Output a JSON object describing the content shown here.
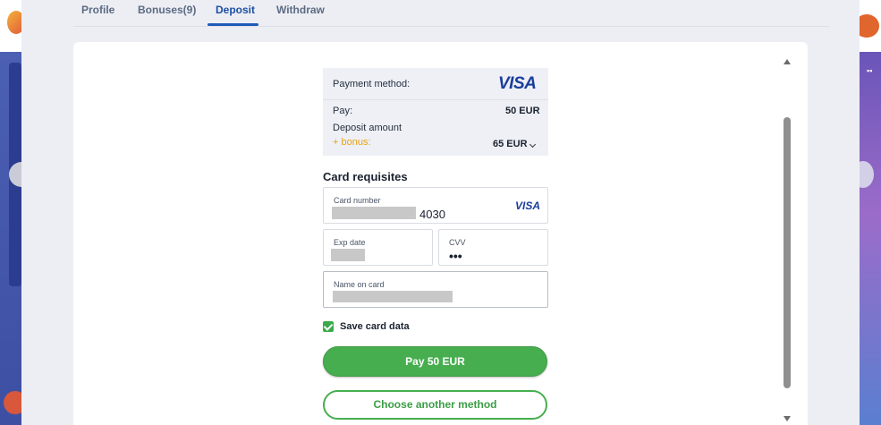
{
  "tabs": {
    "profile": "Profile",
    "bonuses": "Bonuses(9)",
    "deposit": "Deposit",
    "withdraw": "Withdraw",
    "active": "Deposit"
  },
  "summary": {
    "payment_method_label": "Payment method:",
    "payment_method_brand": "VISA",
    "pay_label": "Pay:",
    "pay_value": "50 EUR",
    "deposit_amount_label": "Deposit amount",
    "bonus_label": "+ bonus:",
    "deposit_amount_value": "65 EUR"
  },
  "card": {
    "section_title": "Card requisites",
    "card_number_label": "Card number",
    "card_number_last4": "4030",
    "card_brand": "VISA",
    "exp_date_label": "Exp date",
    "cvv_label": "CVV",
    "cvv_value": "•••",
    "name_label": "Name on card"
  },
  "save_card": {
    "label": "Save card data",
    "checked": true
  },
  "buttons": {
    "pay": "Pay 50 EUR",
    "other_method": "Choose another method"
  },
  "colors": {
    "accent_green": "#47ae4f",
    "tab_active": "#1d4fa3",
    "bonus_orange": "#e8a10f",
    "visa_blue": "#1a3d9c"
  }
}
